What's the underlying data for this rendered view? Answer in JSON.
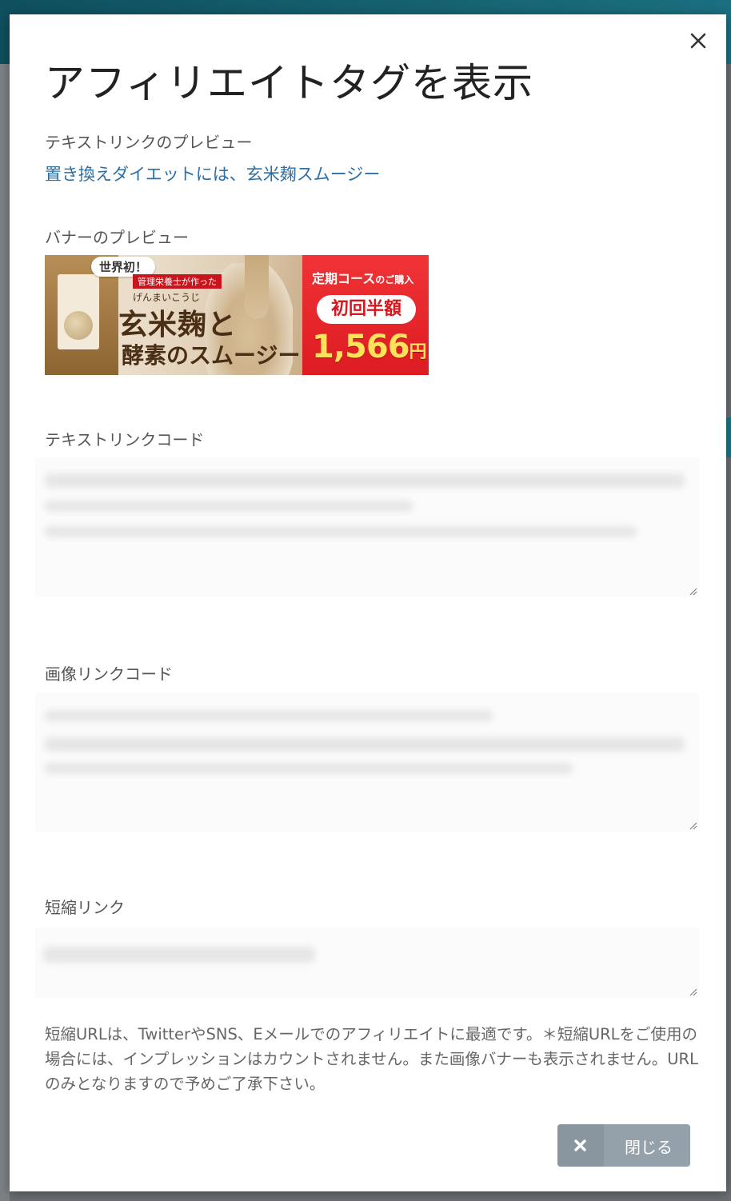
{
  "modal": {
    "title": "アフィリエイトタグを表示",
    "text_preview_label": "テキストリンクのプレビュー",
    "text_preview_link": "置き換えダイエットには、玄米麹スムージー",
    "banner_preview_label": "バナーのプレビュー",
    "banner": {
      "badge": "世界初！",
      "maker": "管理栄養士が作った",
      "reading": "げんまいこうじ",
      "product_line1": "玄米麹と",
      "product_line2": "酵素のスムージー",
      "course": "定期コース",
      "course_suffix": "のご購入",
      "first_half": "初回半額",
      "price": "1,566",
      "currency": "円"
    },
    "text_code_label": "テキストリンクコード",
    "image_code_label": "画像リンクコード",
    "short_link_label": "短縮リンク",
    "note": "短縮URLは、TwitterやSNS、Eメールでのアフィリエイトに最適です。＊短縮URLをご使用の場合には、インプレッションはカウントされません。また画像バナーも表示されません。URLのみとなりますので予めご了承下さい。",
    "close_button_label": "閉じる"
  },
  "icons": {
    "close": "close-icon",
    "button_close": "x-icon",
    "resize": "resize-grip-icon"
  },
  "colors": {
    "link": "#2c6fa6",
    "button_bg": "#95a1aa",
    "banner_red": "#e11f25",
    "banner_price": "#ffe15a",
    "topbar": "#0f4f5e"
  }
}
